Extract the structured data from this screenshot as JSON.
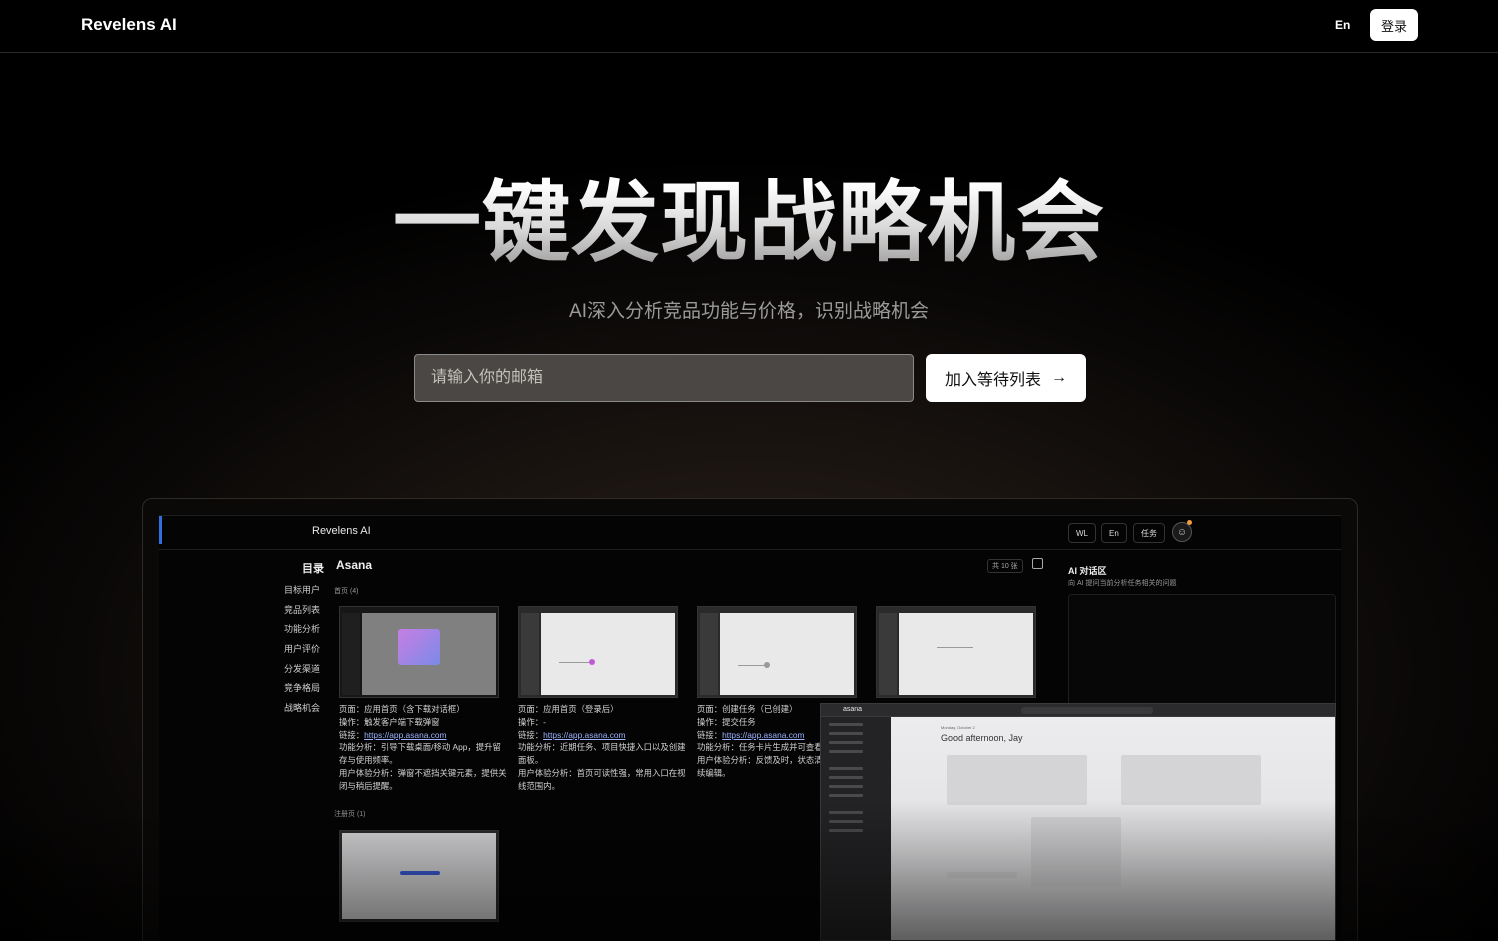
{
  "nav": {
    "brand": "Revelens AI",
    "lang": "En",
    "login": "登录"
  },
  "hero": {
    "headline": "一键发现战略机会",
    "subtitle": "AI深入分析竞品功能与价格，识别战略机会",
    "email_placeholder": "请输入你的邮箱",
    "join_label": "加入等待列表",
    "join_icon": "arrow-right-icon"
  },
  "preview": {
    "brand": "Revelens AI",
    "pills": [
      "WL",
      "En",
      "任务"
    ],
    "toc_title": "目录",
    "toc": [
      "目标用户",
      "竞品列表",
      "功能分析",
      "用户评价",
      "分发渠道",
      "竞争格局",
      "战略机会"
    ],
    "company": "Asana",
    "count": "共 10 张",
    "section_home": "首页",
    "section_home_count": "(4)",
    "section_create": "注册页",
    "section_create_count": "(1)",
    "cards": [
      {
        "page": "页面：应用首页（含下载对话框）",
        "action": "操作：触发客户端下载弹窗",
        "link_label": "链接：",
        "link": "https://app.asana.com",
        "func": "功能分析：引导下载桌面/移动 App，提升留存与使用频率。",
        "ux": "用户体验分析：弹窗不遮挡关键元素，提供关闭与稍后提醒。"
      },
      {
        "page": "页面：应用首页（登录后）",
        "action": "操作：-",
        "link_label": "链接：",
        "link": "https://app.asana.com",
        "func": "功能分析：近期任务、项目快捷入口以及创建面板。",
        "ux": "用户体验分析：首页可读性强，常用入口在视线范围内。"
      },
      {
        "page": "页面：创建任务（已创建）",
        "action": "操作：提交任务",
        "link_label": "链接：",
        "link": "https://app.asana.com",
        "func": "功能分析：任务卡片生成并可查看详细信息。",
        "ux": "用户体验分析：反馈及时，状态清晰，便于继续编辑。"
      }
    ],
    "ai_title": "AI 对话区",
    "ai_sub": "向 AI 提问当前分析任务相关的问题",
    "overlay": {
      "logo": "asana",
      "date": "Monday, October 2",
      "greeting": "Good afternoon, Jay"
    }
  }
}
